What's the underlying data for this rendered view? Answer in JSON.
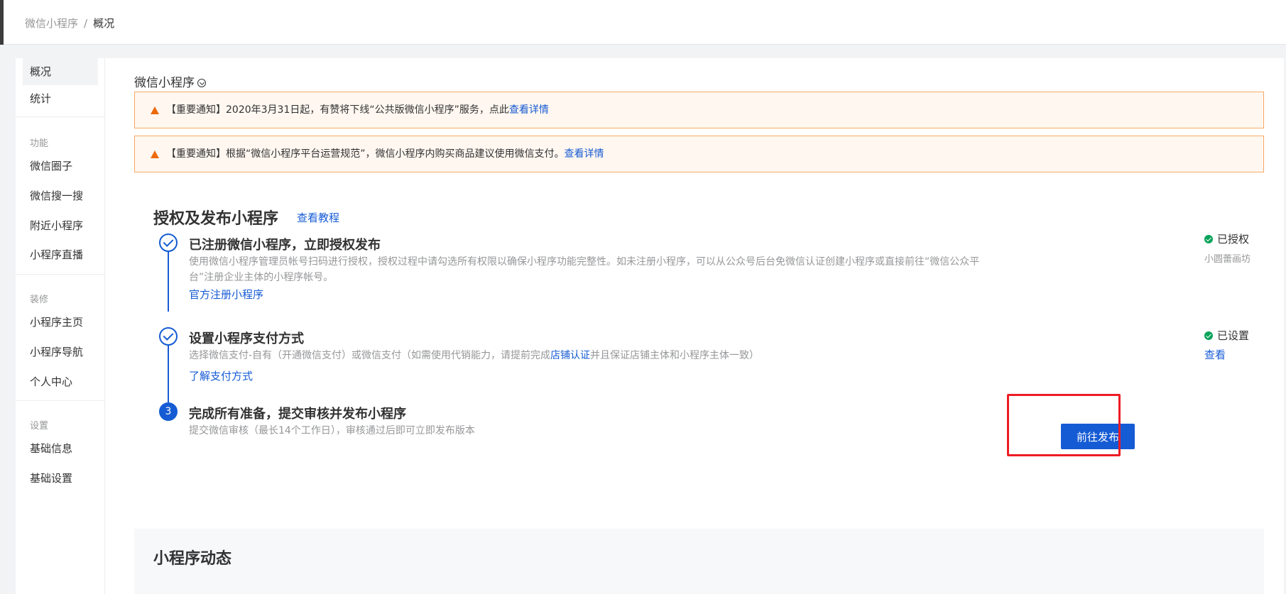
{
  "breadcrumb": {
    "parent": "微信小程序",
    "separator": "/",
    "current": "概况"
  },
  "sidebar": {
    "top_items": [
      {
        "label": "概况"
      },
      {
        "label": "统计"
      }
    ],
    "groups": [
      {
        "title": "功能",
        "items": [
          {
            "label": "微信圈子"
          },
          {
            "label": "微信搜一搜"
          },
          {
            "label": "附近小程序"
          },
          {
            "label": "小程序直播"
          }
        ]
      },
      {
        "title": "装修",
        "items": [
          {
            "label": "小程序主页"
          },
          {
            "label": "小程序导航"
          },
          {
            "label": "个人中心"
          }
        ]
      },
      {
        "title": "设置",
        "items": [
          {
            "label": "基础信息"
          },
          {
            "label": "基础设置"
          }
        ]
      }
    ]
  },
  "main": {
    "title": "微信小程序",
    "notices": [
      {
        "text": "【重要通知】2020年3月31日起，有赞将下线“公共版微信小程序”服务，点此",
        "link": "查看详情"
      },
      {
        "text": "【重要通知】根据“微信小程序平台运营规范”，微信小程序内购买商品建议使用微信支付。",
        "link": "查看详情"
      }
    ],
    "section": {
      "title": "授权及发布小程序",
      "link": "查看教程"
    },
    "steps": [
      {
        "title": "已注册微信小程序，立即授权发布",
        "desc": "使用微信小程序管理员帐号扫码进行授权，授权过程中请勾选所有权限以确保小程序功能完整性。如未注册小程序，可以从公众号后台免微信认证创建小程序或直接前往“微信公众平台”注册企业主体的小程序帐号。",
        "link": "官方注册小程序",
        "status": "已授权",
        "status_sub": "小圆蕾画坊"
      },
      {
        "title": "设置小程序支付方式",
        "desc_before": "选择微信支付-自有（开通微信支付）或微信支付（如需使用代销能力，请提前完成",
        "desc_link": "店铺认证",
        "desc_after": "并且保证店铺主体和小程序主体一致）",
        "link": "了解支付方式",
        "status": "已设置",
        "status_link": "查看"
      },
      {
        "number": "3",
        "title": "完成所有准备，提交审核并发布小程序",
        "desc": "提交微信审核（最长14个工作日），审核通过后即可立即发布版本",
        "button": "前往发布"
      }
    ],
    "dynamic": {
      "title": "小程序动态"
    }
  },
  "colors": {
    "accent": "#155bd4",
    "success": "#07a35a",
    "warning": "#ed6a0c",
    "highlight": "#ee1c25"
  }
}
